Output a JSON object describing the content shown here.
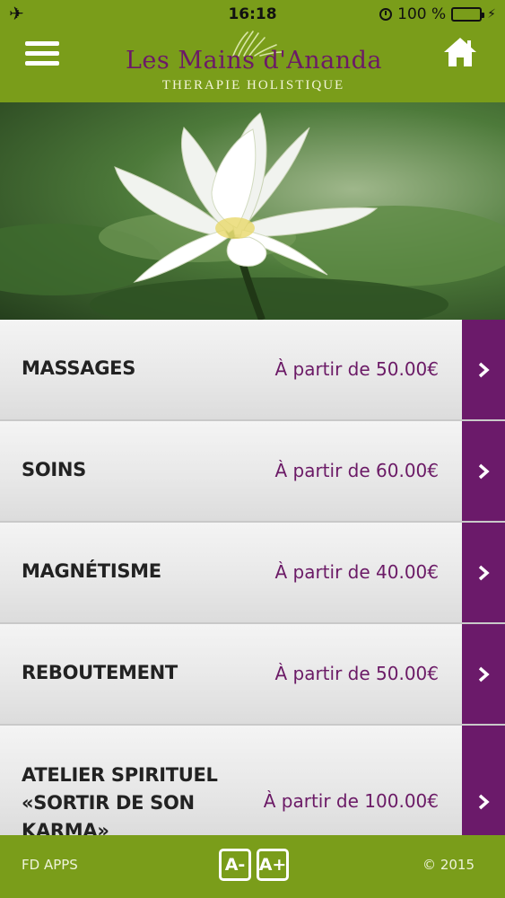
{
  "status_bar": {
    "time": "16:18",
    "battery_text": "100 %",
    "battery_level": 1.0,
    "icons": [
      "airplane-icon",
      "alarm-icon",
      "battery-icon",
      "charging-icon"
    ]
  },
  "header": {
    "menu_icon": "hamburger-menu-icon",
    "logo_title": "Les Mains d'Ananda",
    "logo_subtitle": "THERAPIE HOLISTIQUE",
    "home_icon": "home-icon"
  },
  "services": [
    {
      "name": "MASSAGES",
      "price": "À partir de 50.00€"
    },
    {
      "name": "SOINS",
      "price": "À partir de 60.00€"
    },
    {
      "name": "MAGNÉTISME",
      "price": "À partir de 40.00€"
    },
    {
      "name": "REBOUTEMENT",
      "price": "À partir de 50.00€"
    },
    {
      "name_lines": [
        "ATELIER SPIRITUEL",
        "«SORTIR DE SON",
        "KARMA»"
      ],
      "price": "À partir de 100.00€"
    }
  ],
  "footer": {
    "left": "FD APPS",
    "font_decrease": "A-",
    "font_increase": "A+",
    "right": "© 2015"
  },
  "colors": {
    "brand_green": "#7a9d1a",
    "brand_purple": "#6b1a6a"
  }
}
